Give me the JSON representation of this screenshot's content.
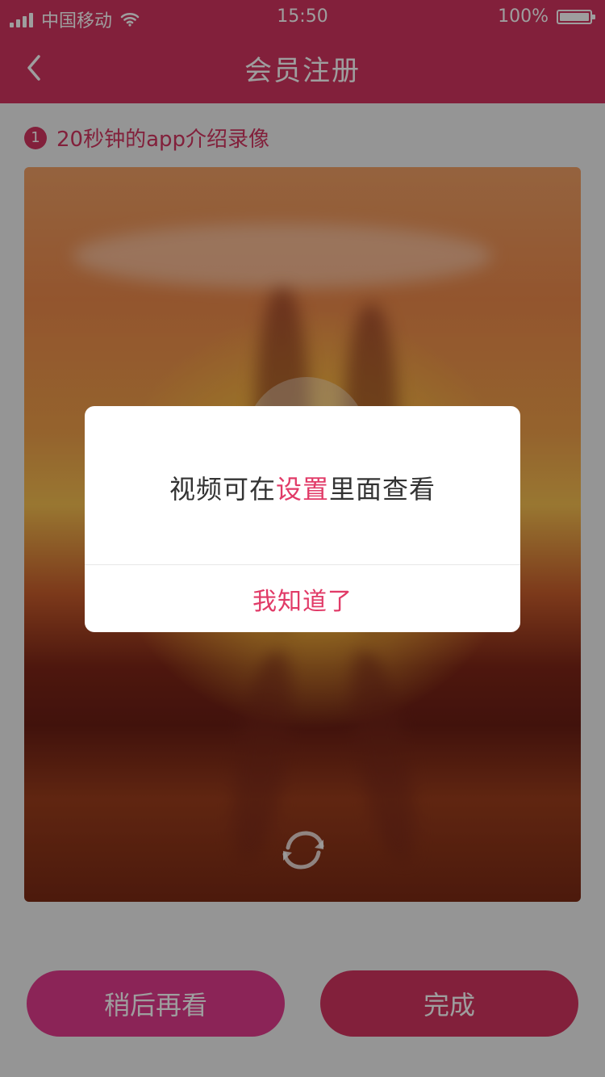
{
  "status_bar": {
    "carrier": "中国移动",
    "time": "15:50",
    "battery": "100%"
  },
  "header": {
    "title": "会员注册"
  },
  "main": {
    "step_number": "1",
    "step_text": "20秒钟的app介绍录像"
  },
  "buttons": {
    "later": "稍后再看",
    "done": "完成"
  },
  "dialog": {
    "message_prefix": "视频可在",
    "message_highlight": "设置",
    "message_suffix": "里面查看",
    "confirm": "我知道了"
  },
  "colors": {
    "primary": "#d2345f",
    "secondary": "#e03a8d",
    "highlight": "#e13a67"
  },
  "icons": {
    "back": "chevron-left-icon",
    "wifi": "wifi-icon",
    "signal": "signal-icon",
    "battery": "battery-icon",
    "refresh": "refresh-icon"
  }
}
